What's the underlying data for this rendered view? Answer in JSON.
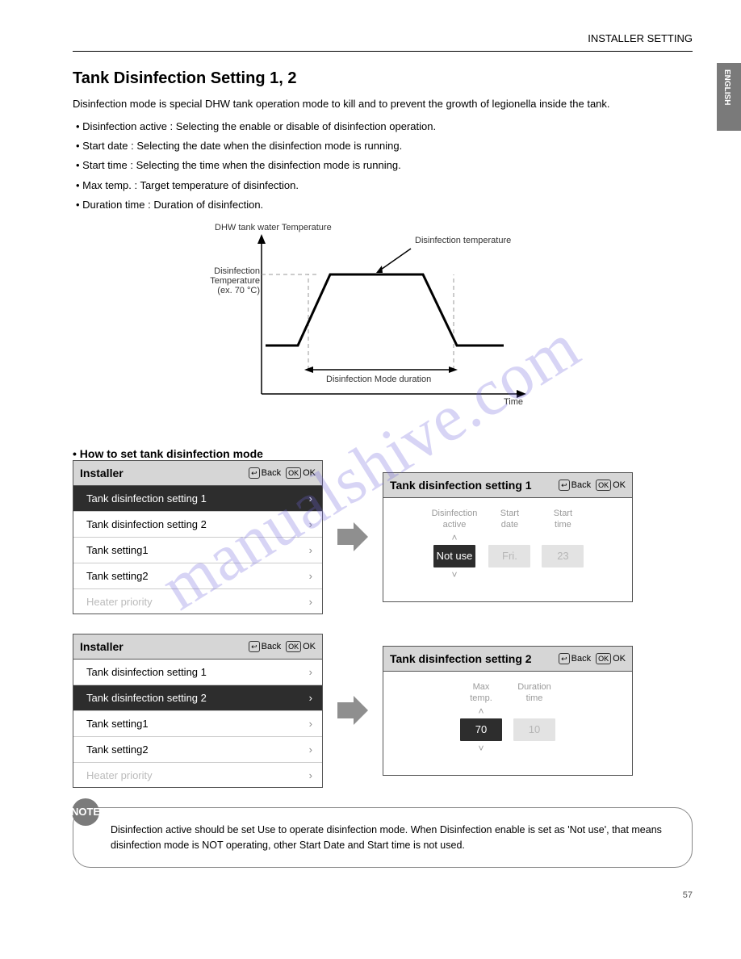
{
  "header": {
    "right": "INSTALLER SETTING",
    "sidetab": "ENGLISH"
  },
  "section": {
    "title": "Tank Disinfection Setting 1, 2",
    "intro": "Disinfection mode is special DHW tank operation mode to kill and to prevent the growth of legionella inside the tank.",
    "bullets": {
      "b1_lead": "• Disinfection active :",
      "b1_rest": " Selecting the enable or disable of disinfection operation.",
      "b2_lead": "• Start date :",
      "b2_rest": " Selecting the date when the disinfection mode is running.",
      "b3_lead": "• Start time :",
      "b3_rest": " Selecting the time when the disinfection mode is running.",
      "b4_lead": "• Max temp. :",
      "b4_rest": " Target temperature of disinfection.",
      "b5_lead": "• Duration time :",
      "b5_rest": " Duration of disinfection."
    },
    "how_to": "• How to set tank disinfection mode"
  },
  "chart_data": {
    "type": "line",
    "title": "Disinfection temperature profile",
    "xlabel": "Time",
    "ylabel": "DHW tank water Temperature",
    "y_marker_high": "Disinfection Temperature (ex. 70 °C)",
    "x_span_label": "Disinfection Mode duration",
    "arrow_annotation": "Disinfection temperature",
    "profile_points": [
      {
        "x": 0,
        "y": 35
      },
      {
        "x": 20,
        "y": 35
      },
      {
        "x": 35,
        "y": 70
      },
      {
        "x": 70,
        "y": 70
      },
      {
        "x": 85,
        "y": 35
      },
      {
        "x": 100,
        "y": 35
      }
    ],
    "ylim": [
      0,
      80
    ]
  },
  "panel_common": {
    "installer": "Installer",
    "back": "Back",
    "ok": "OK",
    "back_glyph": "↩",
    "ok_glyph": "OK"
  },
  "menu_items": {
    "m1": "Tank disinfection setting 1",
    "m2": "Tank disinfection setting 2",
    "m3": "Tank setting1",
    "m4": "Tank setting2",
    "m5": "Heater priority"
  },
  "detail1": {
    "title": "Tank disinfection setting 1",
    "labels": {
      "active": "Disinfection\nactive",
      "date": "Start\ndate",
      "time": "Start\ntime"
    },
    "values": {
      "active": "Not use",
      "date": "Fri.",
      "time": "23"
    }
  },
  "detail2": {
    "title": "Tank disinfection setting 2",
    "labels": {
      "max": "Max\ntemp.",
      "dur": "Duration\ntime"
    },
    "values": {
      "max": "70",
      "dur": "10"
    }
  },
  "note": {
    "badge": "NOTE",
    "body": "Disinfection active should be set Use to operate disinfection mode. When Disinfection enable is set as 'Not use', that means disinfection mode is NOT operating, other Start Date and Start time is not used."
  },
  "watermark": "manualshive.com",
  "footer": {
    "left": "",
    "right": "57"
  },
  "carets": {
    "up": "˄",
    "down": "˅"
  }
}
